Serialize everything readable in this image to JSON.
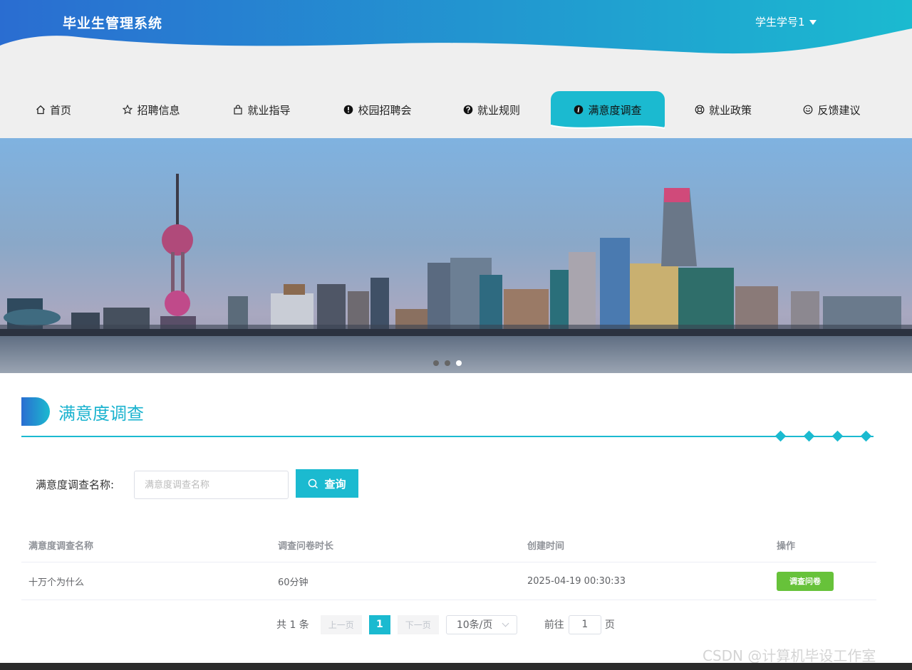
{
  "header": {
    "site_title": "毕业生管理系统",
    "user_label": "学生学号1",
    "gradient_start": "#2a6dd1",
    "gradient_end": "#1bbad0"
  },
  "nav": {
    "items": [
      {
        "label": "首页",
        "icon": "home-icon",
        "active": false
      },
      {
        "label": "招聘信息",
        "icon": "star-icon",
        "active": false
      },
      {
        "label": "就业指导",
        "icon": "bag-icon",
        "active": false
      },
      {
        "label": "校园招聘会",
        "icon": "exclamation-circle-icon",
        "active": false
      },
      {
        "label": "就业规则",
        "icon": "question-circle-icon",
        "active": false
      },
      {
        "label": "满意度调查",
        "icon": "info-circle-icon",
        "active": true
      },
      {
        "label": "就业政策",
        "icon": "lifebuoy-icon",
        "active": false
      },
      {
        "label": "反馈建议",
        "icon": "smile-icon",
        "active": false
      }
    ],
    "accent": "#1bbad0"
  },
  "banner": {
    "slide_count": 3,
    "active_slide": 3
  },
  "section": {
    "title": "满意度调查"
  },
  "search": {
    "label": "满意度调查名称:",
    "placeholder": "满意度调查名称",
    "value": "",
    "button_label": "查询"
  },
  "table": {
    "columns": [
      "满意度调查名称",
      "调查问卷时长",
      "创建时间",
      "操作"
    ],
    "rows": [
      {
        "name": "十万个为什么",
        "duration": "60分钟",
        "created": "2025-04-19 00:30:33",
        "action": "调查问卷"
      }
    ]
  },
  "pagination": {
    "total": "共 1 条",
    "prev": "上一页",
    "current": "1",
    "next": "下一页",
    "page_size": "10条/页",
    "goto_prefix": "前往",
    "goto_value": "1",
    "goto_suffix": "页"
  },
  "watermark": "CSDN @计算机毕设工作室"
}
